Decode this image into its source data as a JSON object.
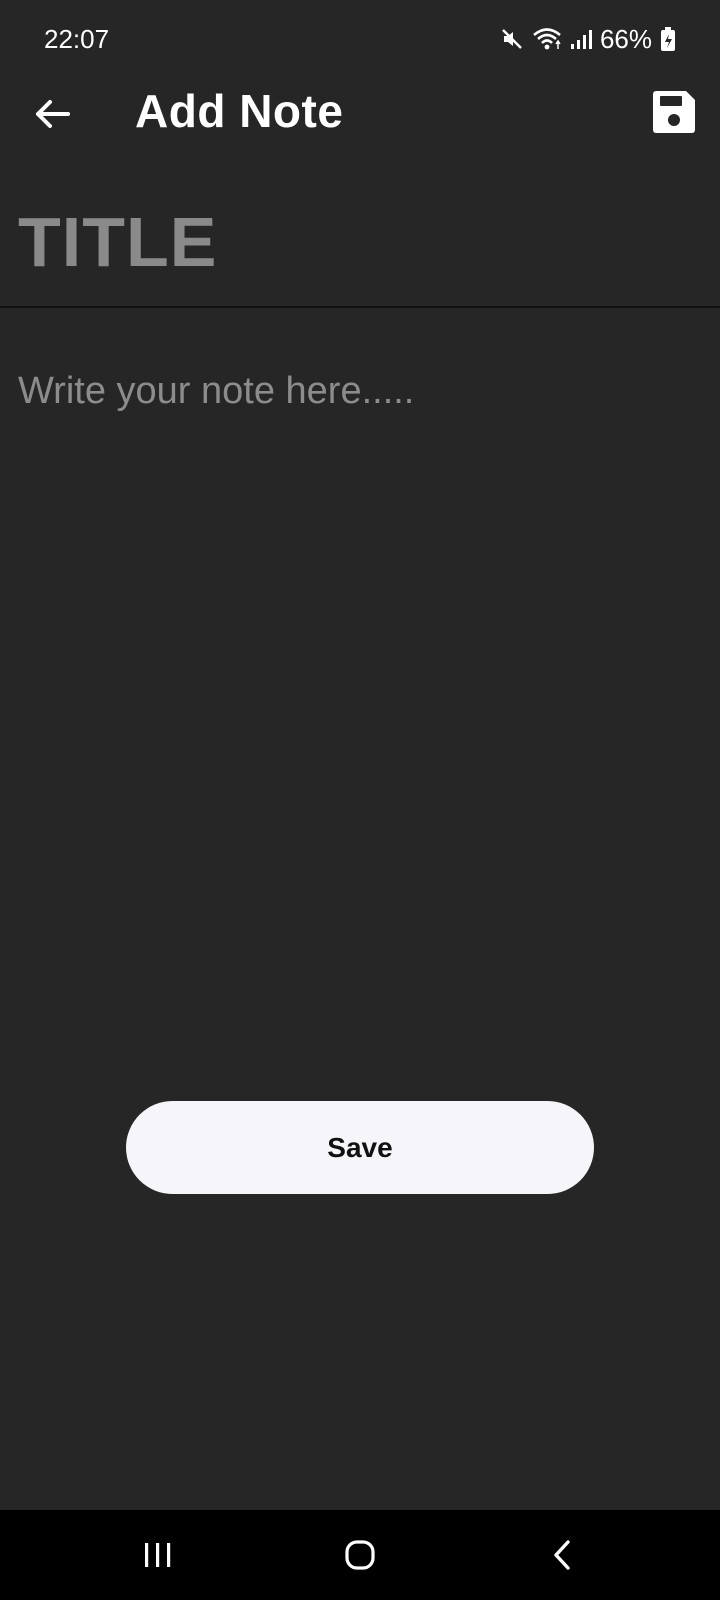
{
  "status_bar": {
    "time": "22:07",
    "battery_percent": "66%",
    "icons": [
      "mute-icon",
      "wifi-icon",
      "signal-icon",
      "battery-icon"
    ]
  },
  "app_bar": {
    "title": "Add Note",
    "back_icon": "back-arrow-icon",
    "save_icon": "floppy-disk-icon"
  },
  "editor": {
    "title_placeholder": "TITLE",
    "body_placeholder": "Write your note here....."
  },
  "actions": {
    "save_label": "Save"
  },
  "nav_bar": {
    "icons": [
      "recents-icon",
      "home-icon",
      "back-icon"
    ]
  },
  "colors": {
    "background": "#262626",
    "placeholder": "#8a8a8a",
    "button_bg": "#f5f5fa",
    "nav_bg": "#000000"
  }
}
